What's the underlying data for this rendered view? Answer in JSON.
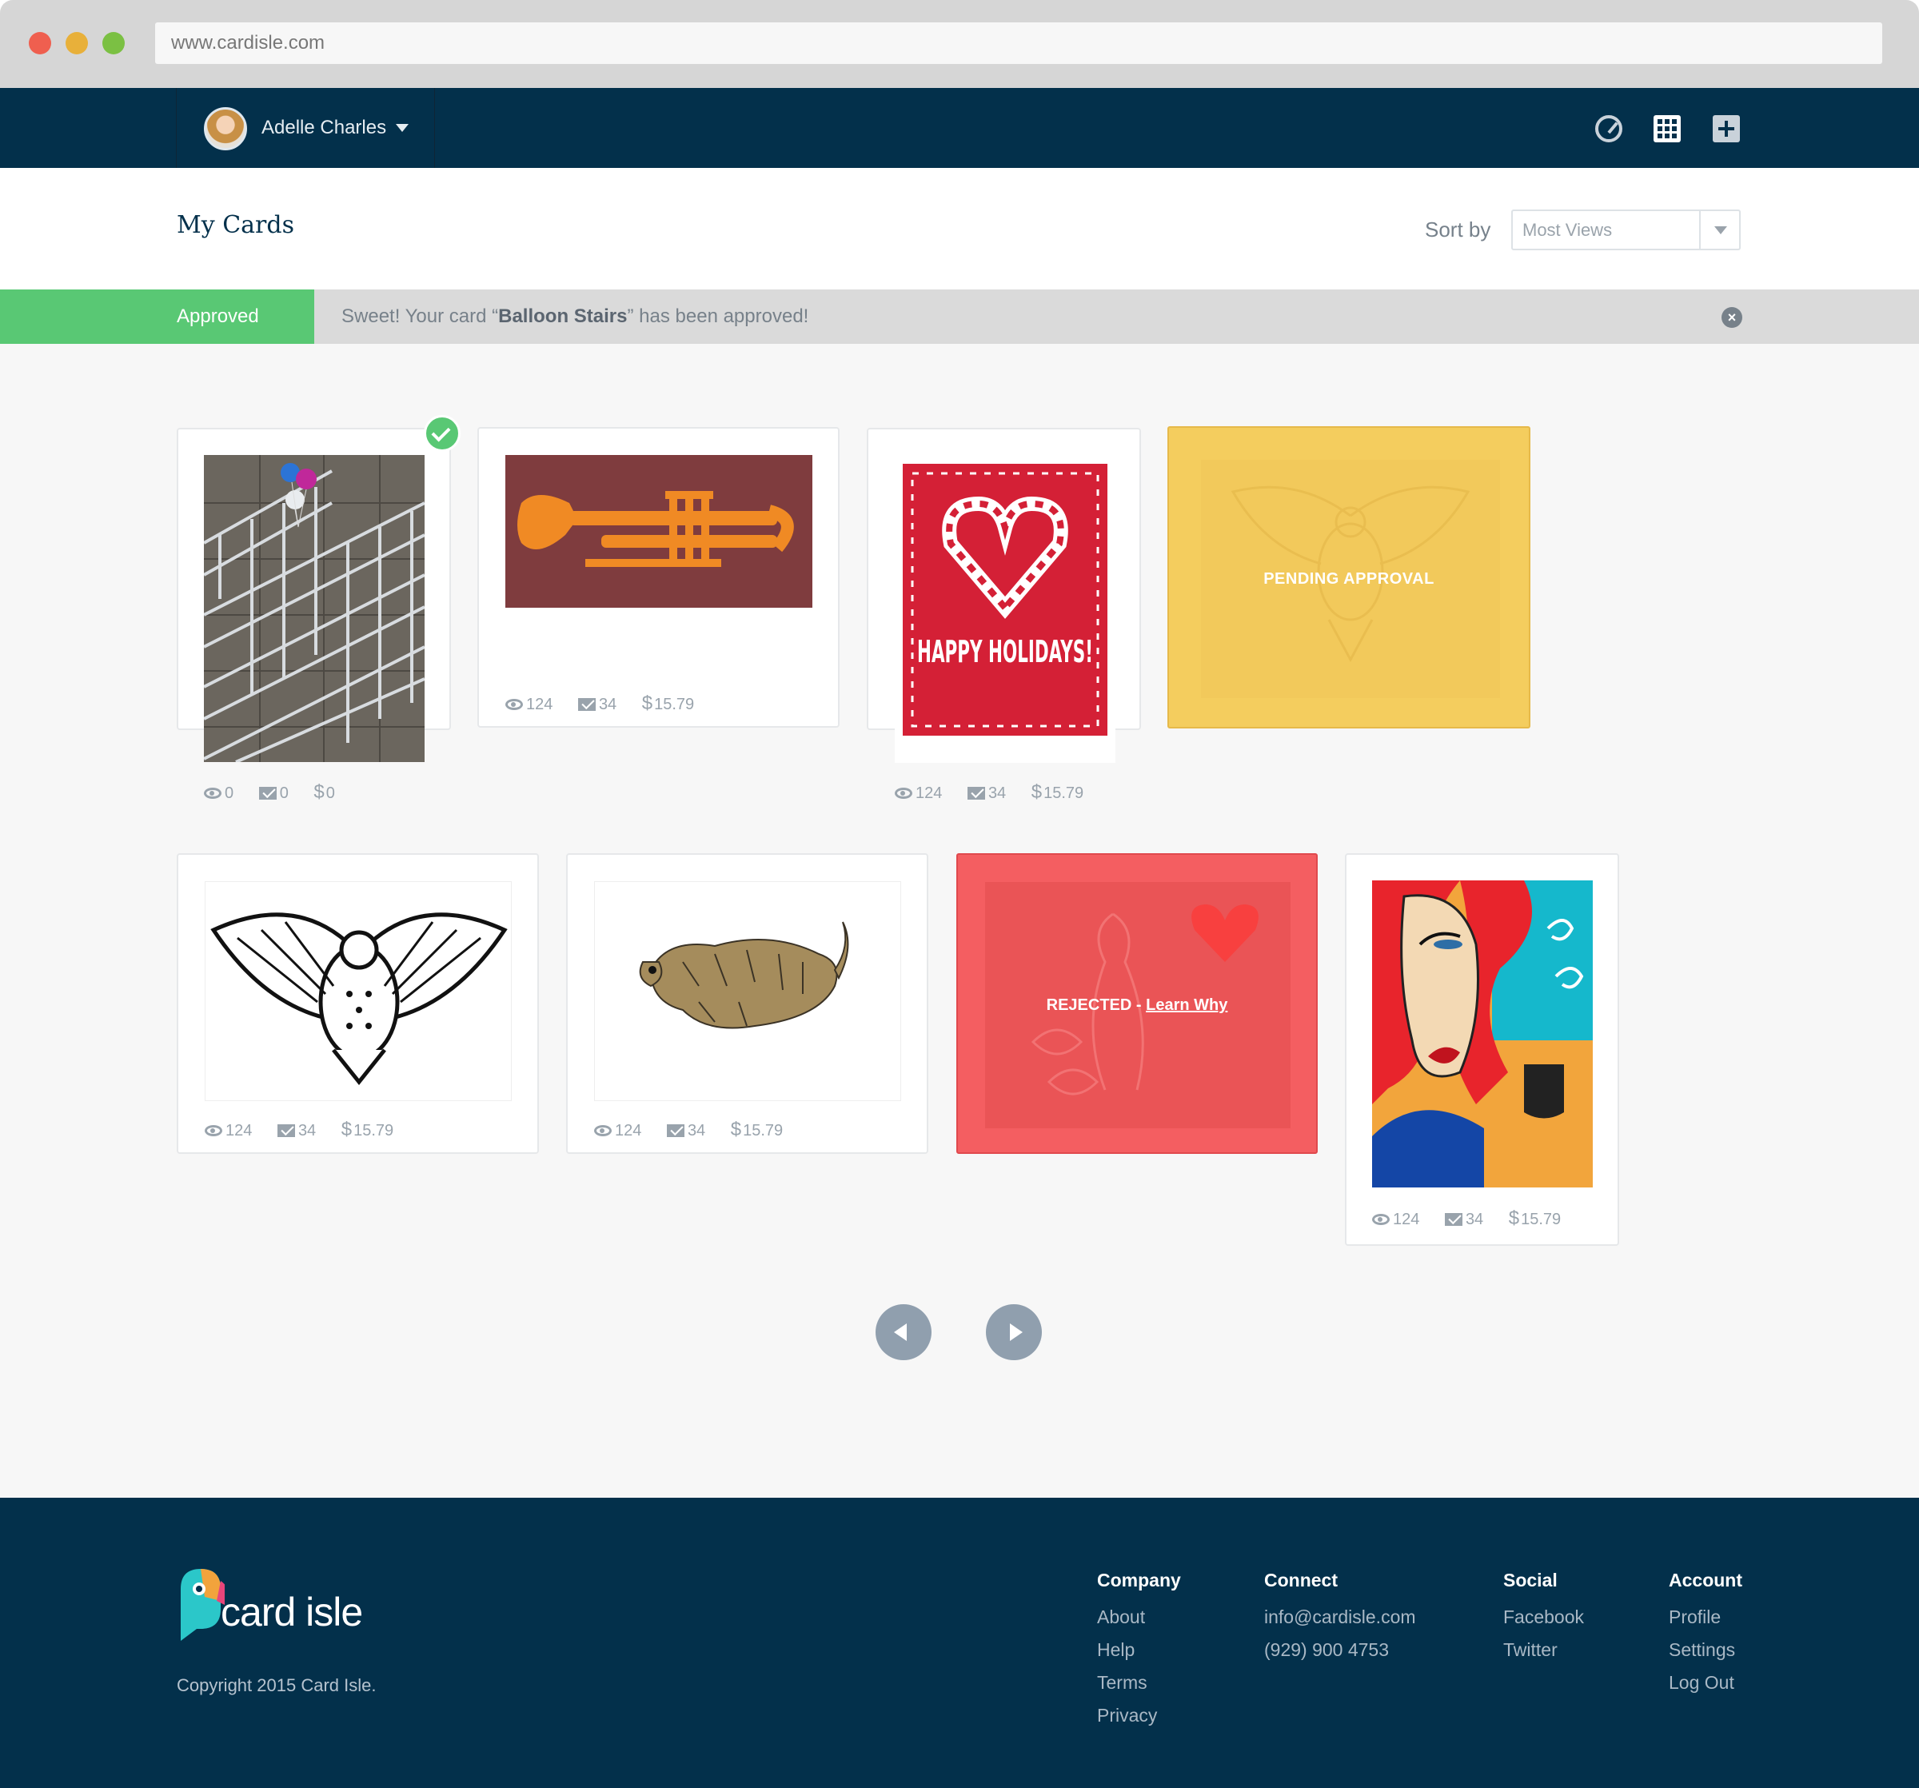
{
  "browser": {
    "url": "www.cardisle.com"
  },
  "nav": {
    "user_name": "Adelle Charles"
  },
  "page": {
    "title": "My Cards",
    "sort_label": "Sort by",
    "sort_value": "Most Views"
  },
  "notice": {
    "tag": "Approved",
    "prefix": "Sweet! Your card “",
    "card_name": "Balloon Stairs",
    "suffix": "” has been approved!",
    "close": "×"
  },
  "cards": [
    {
      "name": "Balloon Stairs",
      "views": "0",
      "sends": "0",
      "earnings": "0",
      "approved": true
    },
    {
      "name": "Trumpet",
      "views": "124",
      "sends": "34",
      "earnings": "15.79"
    },
    {
      "name": "Happy Holidays",
      "art_text": "HAPPY HOLIDAYS!",
      "views": "124",
      "sends": "34",
      "earnings": "15.79"
    },
    {
      "name": "Owl (pending)",
      "status": "PENDING APPROVAL"
    },
    {
      "name": "Owl",
      "views": "124",
      "sends": "34",
      "earnings": "15.79"
    },
    {
      "name": "Dog",
      "views": "124",
      "sends": "34",
      "earnings": "15.79"
    },
    {
      "name": "Heart (rejected)",
      "status": "REJECTED - ",
      "status_link": "Learn Why"
    },
    {
      "name": "Coffee Woman",
      "views": "124",
      "sends": "34",
      "earnings": "15.79"
    }
  ],
  "currency_symbol": "$",
  "footer": {
    "brand": "card isle",
    "copyright": "Copyright 2015 Card Isle.",
    "columns": [
      {
        "title": "Company",
        "links": [
          "About",
          "Help",
          "Terms",
          "Privacy"
        ]
      },
      {
        "title": "Connect",
        "links": [
          "info@cardisle.com",
          "(929) 900 4753"
        ]
      },
      {
        "title": "Social",
        "links": [
          "Facebook",
          "Twitter"
        ]
      },
      {
        "title": "Account",
        "links": [
          "Profile",
          "Settings",
          "Log Out"
        ]
      }
    ]
  },
  "colors": {
    "navy": "#03304b",
    "green": "#59c874",
    "pending": "#f4cd5e",
    "rejected": "#f45e61"
  }
}
